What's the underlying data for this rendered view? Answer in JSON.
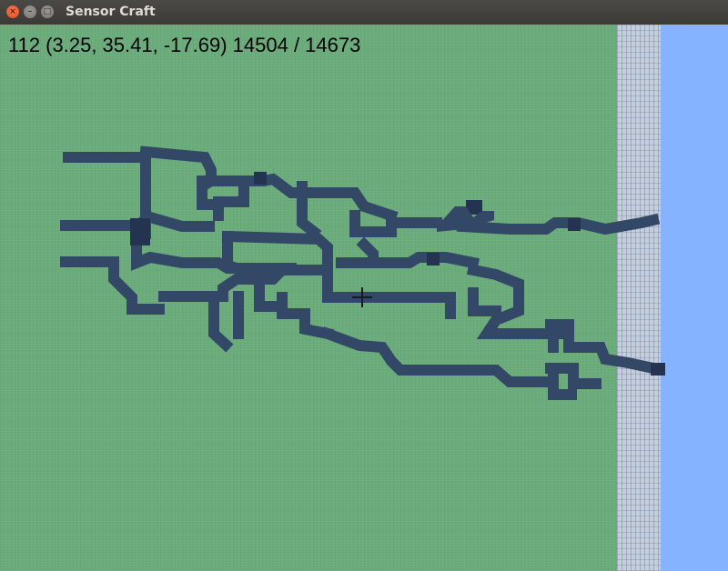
{
  "window": {
    "title": "Sensor Craft",
    "close_glyph": "×",
    "minimize_glyph": "–",
    "maximize_glyph": "□"
  },
  "hud": {
    "readout": "112 (3.25, 35.41, -17.69) 14504 / 14673"
  },
  "colors": {
    "ground": "#6aac7a",
    "blocks": "#334766",
    "block_edge": "#1c2a40",
    "wall": "#c4cedd",
    "sky": "#86b3ff"
  }
}
